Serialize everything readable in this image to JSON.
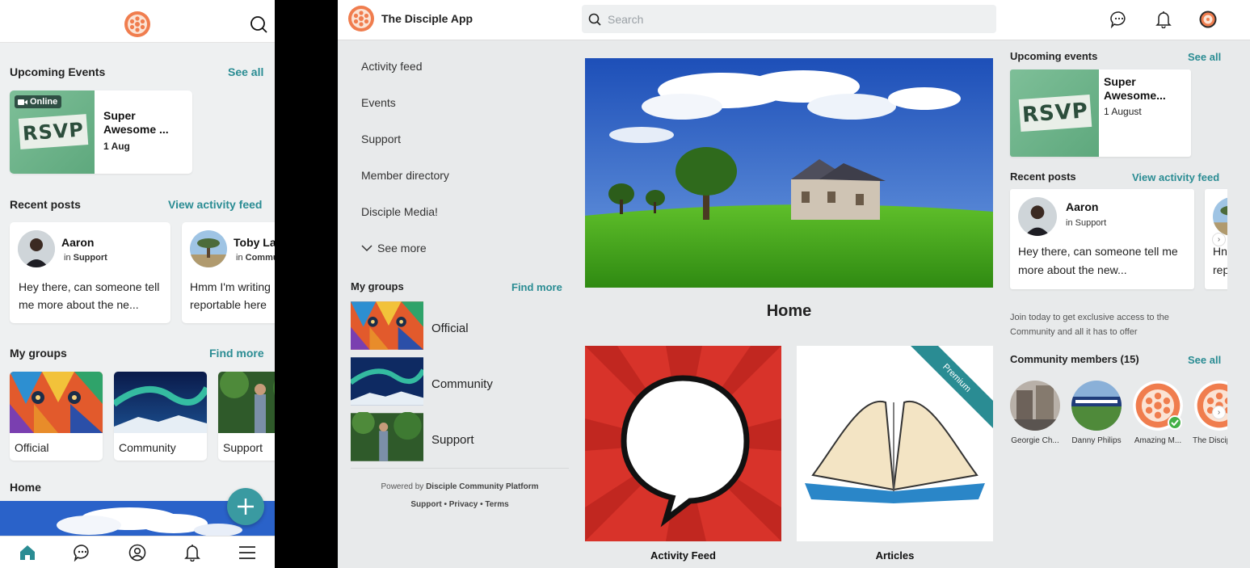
{
  "mobile": {
    "upcoming_events": {
      "title": "Upcoming Events",
      "see_all": "See all"
    },
    "event": {
      "badge": "Online",
      "rsvp": "RSVP",
      "title": "Super Awesome ...",
      "date": "1 Aug"
    },
    "recent_posts": {
      "title": "Recent posts",
      "link": "View activity feed"
    },
    "posts": [
      {
        "author": "Aaron",
        "in_label": "in",
        "group": "Support",
        "text": "Hey there, can someone tell me more about the ne..."
      },
      {
        "author": "Toby La",
        "in_label": "in",
        "group": "Commu",
        "text": "Hmm I'm writing reportable here"
      }
    ],
    "my_groups": {
      "title": "My groups",
      "link": "Find more"
    },
    "groups": [
      "Official",
      "Community",
      "Support"
    ],
    "home_title": "Home"
  },
  "desktop": {
    "brand": "The Disciple App",
    "search": {
      "placeholder": "Search"
    },
    "nav": [
      "Activity feed",
      "Events",
      "Support",
      "Member directory",
      "Disciple Media!"
    ],
    "see_more": "See more",
    "my_groups": {
      "title": "My groups",
      "link": "Find more"
    },
    "groups": [
      "Official",
      "Community",
      "Support"
    ],
    "footer": {
      "powered_prefix": "Powered by",
      "powered_name": "Disciple Community Platform",
      "links": "Support • Privacy • Terms"
    },
    "home_title": "Home",
    "tiles": [
      {
        "label": "Activity Feed"
      },
      {
        "label": "Articles",
        "ribbon": "Premium"
      }
    ],
    "upcoming_events": {
      "title": "Upcoming events",
      "see_all": "See all"
    },
    "event": {
      "rsvp": "RSVP",
      "title": "Super Awesome...",
      "date": "1 August"
    },
    "recent_posts": {
      "title": "Recent posts",
      "link": "View activity feed"
    },
    "post": {
      "author": "Aaron",
      "in_label": "in Support",
      "text": "Hey there, can someone tell me more about the new...",
      "peek_text": "Hn rep"
    },
    "join_text": "Join today to get exclusive access to the Community and all it has to offer",
    "community": {
      "title": "Community members (15)",
      "see_all": "See all"
    },
    "members": [
      "Georgie Ch...",
      "Danny Philips",
      "Amazing M...",
      "The Discip"
    ]
  },
  "colors": {
    "accent": "#2a8c93",
    "brand_orange": "#f07d4e",
    "fab": "#3a9aa1",
    "verified": "#43b047"
  }
}
